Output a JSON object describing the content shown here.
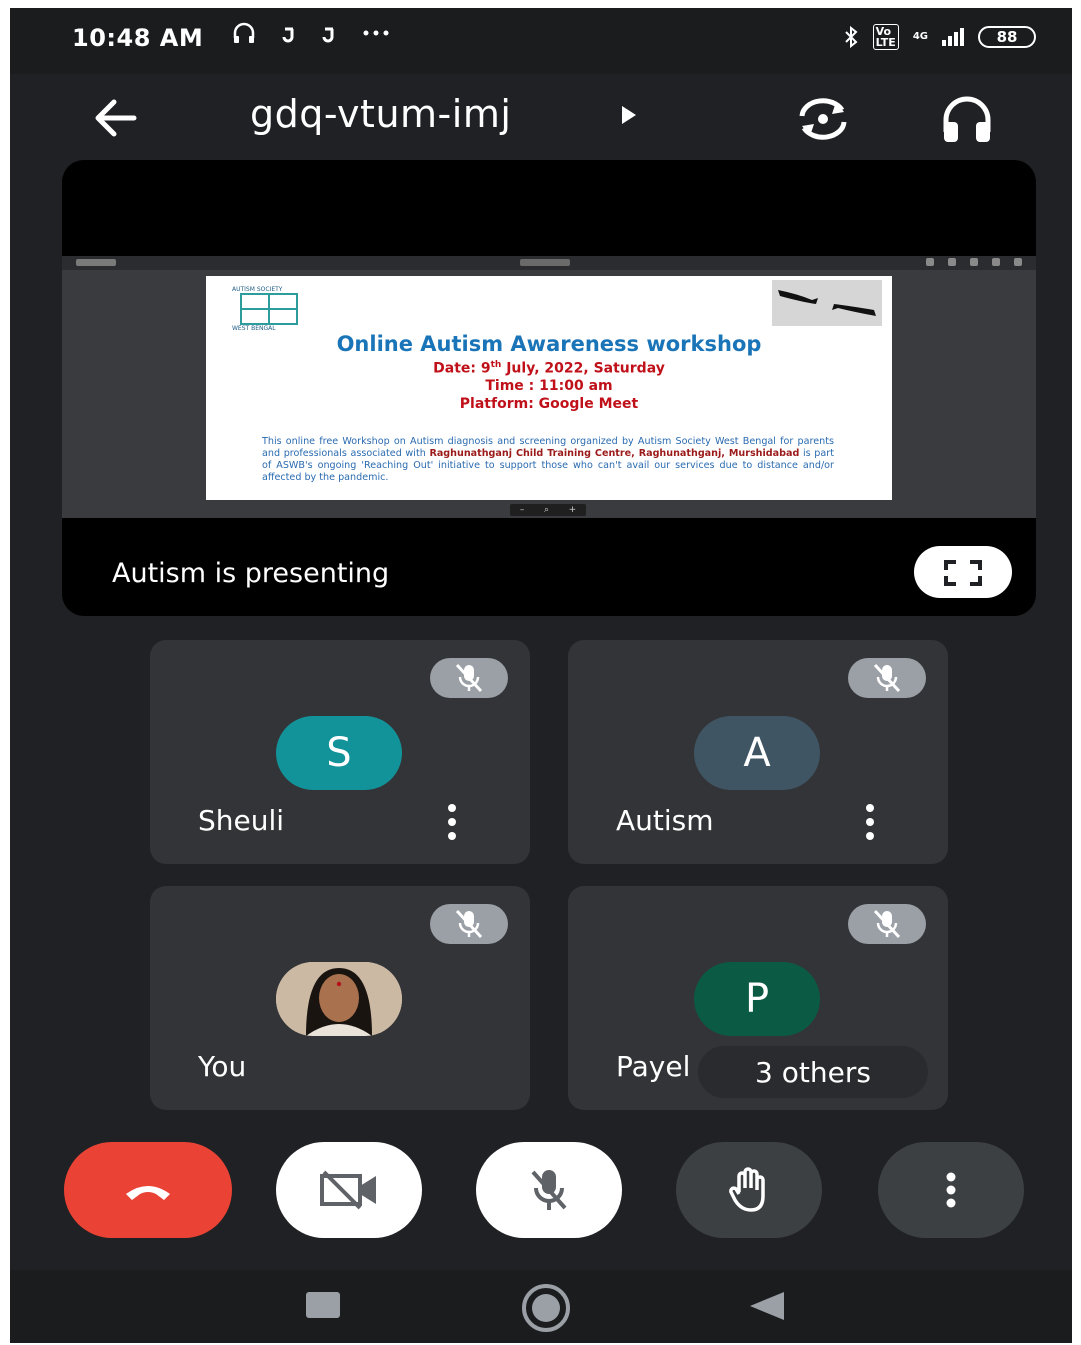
{
  "status_bar": {
    "time": "10:48 AM",
    "left_icons": [
      "headphones-icon",
      "notification-icon",
      "notification-icon",
      "more-notifications-icon"
    ],
    "network": "4G",
    "battery": "88"
  },
  "header": {
    "meeting_code": "gdq-vtum-imj"
  },
  "presentation": {
    "presenter_label": "Autism  is presenting",
    "slide": {
      "logo_top": "AUTISM SOCIETY",
      "logo_bottom": "WEST BENGAL",
      "title": "Online Autism Awareness workshop",
      "date_prefix": "Date: 9",
      "date_sup": "th",
      "date_suffix": " July, 2022, Saturday",
      "time": "Time :  11:00 am",
      "platform": "Platform: Google Meet",
      "body_1": "This online free Workshop on Autism diagnosis and screening organized by Autism Society West Bengal for parents and professionals associated with ",
      "body_bold": "Raghunathganj Child Training Centre, Raghunathganj, Murshidabad",
      "body_2": " is part of ASWB's ongoing 'Reaching Out' initiative  to support those who can't avail our services due to distance and/or affected by the pandemic."
    }
  },
  "participants": [
    {
      "name": "Sheuli",
      "initial": "S",
      "color": "#12939a",
      "muted": true
    },
    {
      "name": "Autism",
      "initial": "A",
      "color": "#3f5563",
      "muted": true
    },
    {
      "name": "You",
      "initial": "",
      "muted": true
    },
    {
      "name": "Payel",
      "initial": "P",
      "color": "#0b5a44",
      "muted": true,
      "others_label": "3 others"
    }
  ],
  "colors": {
    "end_call": "#ea4335",
    "background": "#202124",
    "tile": "#333437"
  }
}
